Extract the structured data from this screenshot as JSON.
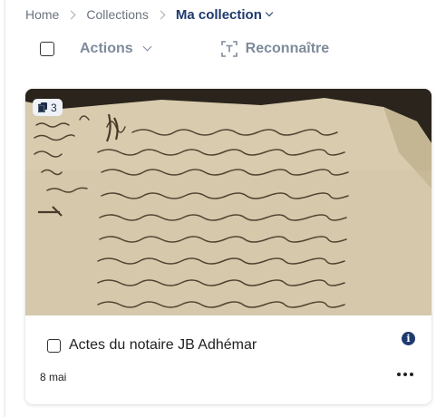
{
  "breadcrumb": {
    "home": "Home",
    "collections": "Collections",
    "current": "Ma collection"
  },
  "toolbar": {
    "actions_label": "Actions",
    "recognize_label": "Reconnaître"
  },
  "card": {
    "page_count": "3",
    "title": "Actes du notaire JB Adhémar",
    "date": "8 mai"
  },
  "colors": {
    "primary": "#1f3a6e",
    "muted": "#7e8b9b",
    "paper": "#d8cbae",
    "ink": "#3a2c1c"
  },
  "icons": {
    "pages": "pages-icon",
    "info": "info-icon",
    "more": "more-horizontal-icon",
    "recognize": "text-recognition-icon"
  }
}
